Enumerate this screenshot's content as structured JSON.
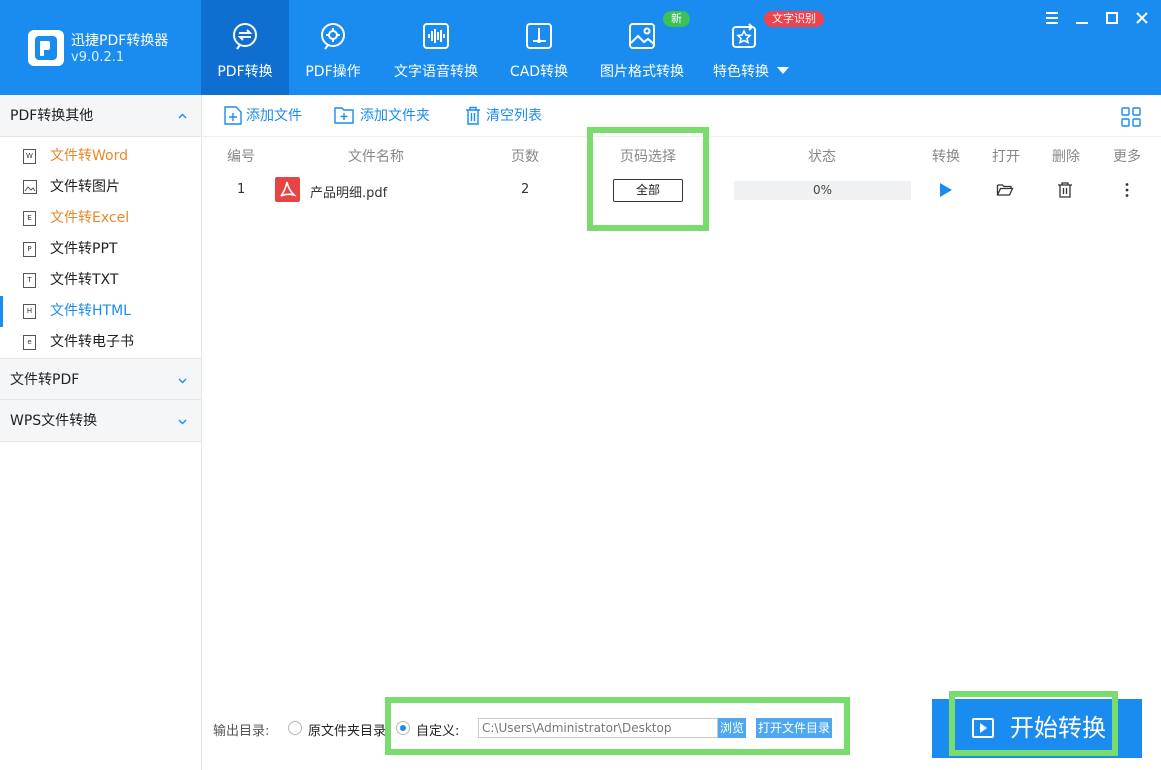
{
  "app": {
    "name": "迅捷PDF转换器",
    "version": "v9.0.2.1"
  },
  "nav": {
    "tabs": [
      {
        "label": "PDF转换",
        "icon": "pdf-convert-icon",
        "active": true
      },
      {
        "label": "PDF操作",
        "icon": "pdf-operate-icon"
      },
      {
        "label": "文字语音转换",
        "icon": "audio-wave-icon"
      },
      {
        "label": "CAD转换",
        "icon": "cad-icon"
      },
      {
        "label": "图片格式转换",
        "icon": "image-icon"
      },
      {
        "label": "特色转换",
        "icon": "feature-icon"
      }
    ],
    "badge_new": "新",
    "badge_ocr": "文字识别"
  },
  "sidebar": {
    "section1": "PDF转换其他",
    "items": [
      {
        "label": "文件转Word",
        "icon": "W"
      },
      {
        "label": "文件转图片",
        "icon": "img"
      },
      {
        "label": "文件转Excel",
        "icon": "E"
      },
      {
        "label": "文件转PPT",
        "icon": "P"
      },
      {
        "label": "文件转TXT",
        "icon": "T"
      },
      {
        "label": "文件转HTML",
        "icon": "H"
      },
      {
        "label": "文件转电子书",
        "icon": "e"
      }
    ],
    "section2": "文件转PDF",
    "section3": "WPS文件转换"
  },
  "toolbar": {
    "add_file": "添加文件",
    "add_folder": "添加文件夹",
    "clear_list": "清空列表"
  },
  "table": {
    "headers": {
      "num": "编号",
      "name": "文件名称",
      "pages": "页数",
      "range": "页码选择",
      "status": "状态",
      "convert": "转换",
      "open": "打开",
      "delete": "删除",
      "more": "更多"
    },
    "rows": [
      {
        "num": "1",
        "name": "产品明细.pdf",
        "pages": "2",
        "range": "全部",
        "progress_text": "0%",
        "progress": 0
      }
    ]
  },
  "output": {
    "label": "输出目录:",
    "opt_original": "原文件夹目录",
    "opt_custom": "自定义:",
    "path": "C:\\Users\\Administrator\\Desktop",
    "browse": "浏览",
    "open_dir": "打开文件目录"
  },
  "start_button": "开始转换",
  "colors": {
    "brand": "#1a8cf0",
    "highlight": "#79dc6e",
    "orange": "#e8872a"
  }
}
